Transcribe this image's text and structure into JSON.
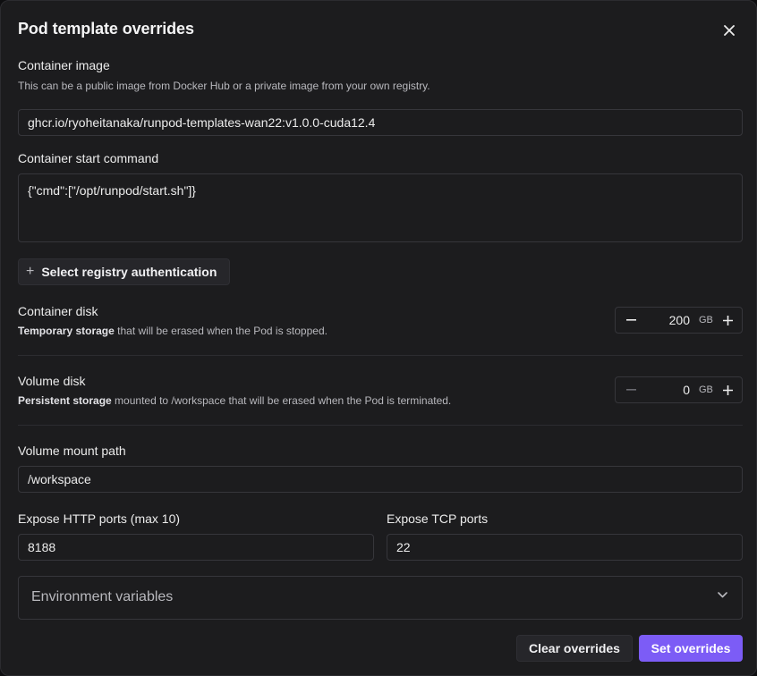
{
  "dialog": {
    "title": "Pod template overrides"
  },
  "container_image": {
    "label": "Container image",
    "help": "This can be a public image from Docker Hub or a private image from your own registry.",
    "value": "ghcr.io/ryoheitanaka/runpod-templates-wan22:v1.0.0-cuda12.4"
  },
  "start_command": {
    "label": "Container start command",
    "value": "{\"cmd\":[\"/opt/runpod/start.sh\"]}"
  },
  "registry": {
    "button_label": "Select registry authentication"
  },
  "container_disk": {
    "label": "Container disk",
    "help_bold": "Temporary storage",
    "help_rest": " that will be erased when the Pod is stopped.",
    "value": "200",
    "unit": "GB"
  },
  "volume_disk": {
    "label": "Volume disk",
    "help_bold": "Persistent storage",
    "help_rest": " mounted to /workspace that will be erased when the Pod is terminated.",
    "value": "0",
    "unit": "GB"
  },
  "volume_mount": {
    "label": "Volume mount path",
    "value": "/workspace"
  },
  "http_ports": {
    "label": "Expose HTTP ports (max 10)",
    "value": "8188"
  },
  "tcp_ports": {
    "label": "Expose TCP ports",
    "value": "22"
  },
  "env_vars": {
    "label": "Environment variables"
  },
  "footer": {
    "clear_label": "Clear overrides",
    "set_label": "Set overrides"
  },
  "colors": {
    "accent": "#7c5cf6",
    "background": "#1c1c1e",
    "border": "#36363b"
  },
  "icons": [
    "close-icon",
    "plus-icon",
    "minus-icon",
    "chevron-down-icon"
  ]
}
